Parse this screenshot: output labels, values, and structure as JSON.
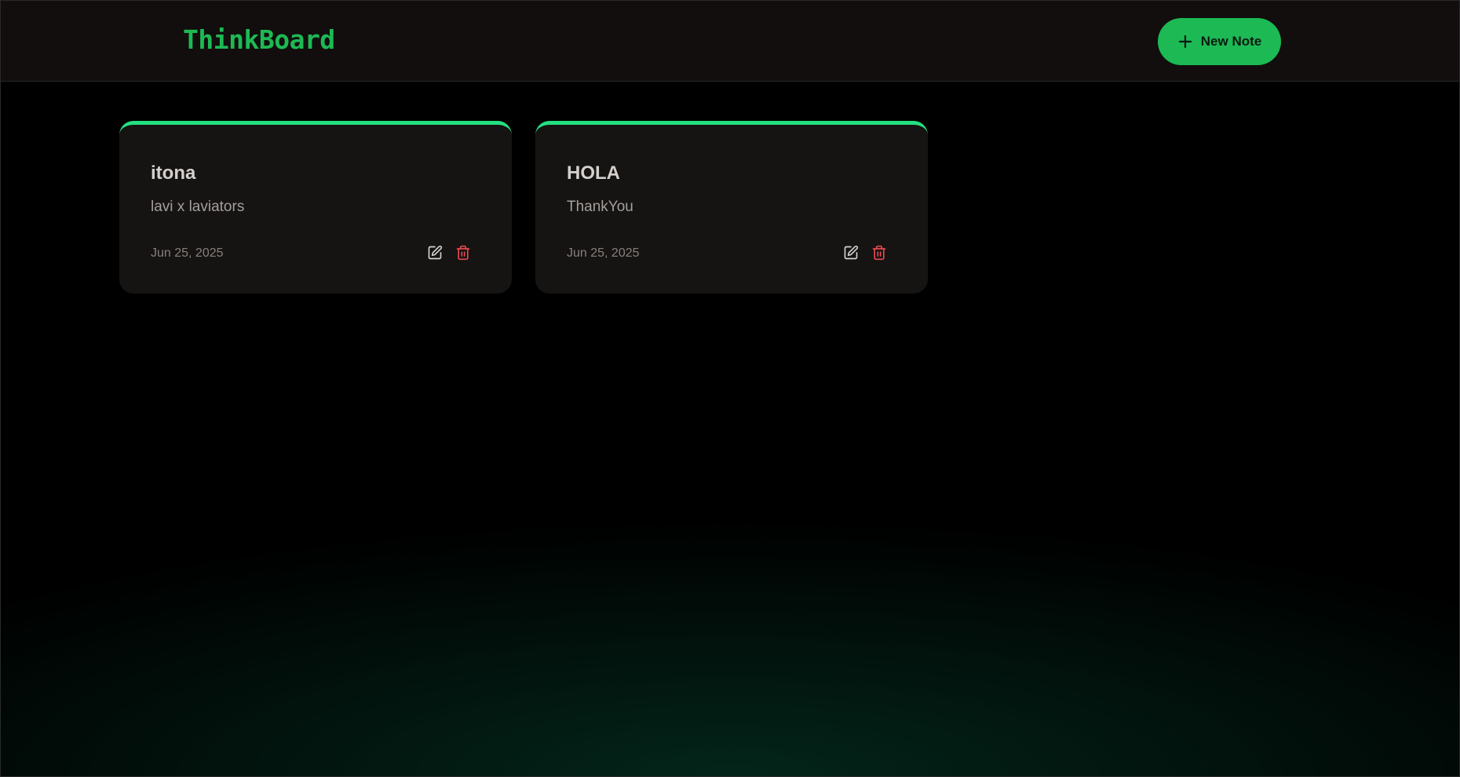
{
  "header": {
    "brand": "ThinkBoard",
    "new_note_label": "New Note"
  },
  "notes": [
    {
      "title": "itona",
      "content": "lavi x laviators",
      "date": "Jun 25, 2025"
    },
    {
      "title": "HOLA",
      "content": "ThankYou",
      "date": "Jun 25, 2025"
    }
  ],
  "icons": {
    "plus": "plus-icon",
    "edit": "pen-square-icon",
    "delete": "trash-icon"
  },
  "colors": {
    "accent": "#1db954",
    "card_top_border": "#23e07f",
    "delete_icon": "#e5484d",
    "edit_icon": "#d4d0cc",
    "background": "#000000",
    "navbar": "#110e0d",
    "card": "#161313"
  }
}
